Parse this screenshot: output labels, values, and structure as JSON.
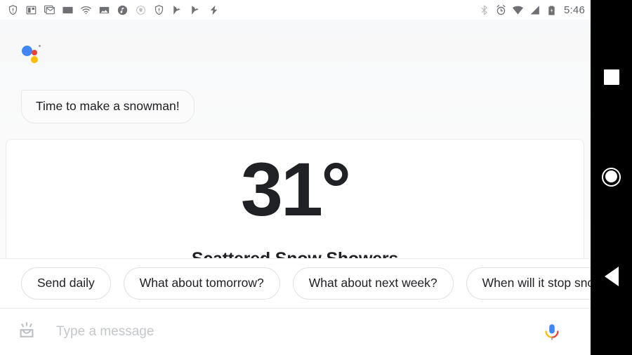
{
  "statusbar": {
    "left_icons": [
      {
        "name": "shield-alert-icon"
      },
      {
        "name": "split-view-icon"
      },
      {
        "name": "gmail-stack-icon"
      },
      {
        "name": "email-icon"
      },
      {
        "name": "wifi-icon"
      },
      {
        "name": "photos-icon"
      },
      {
        "name": "music-note-icon"
      },
      {
        "name": "small-shield-icon"
      },
      {
        "name": "shield-alert-icon-2"
      },
      {
        "name": "flag-check-icon"
      },
      {
        "name": "flag-check-icon-2"
      },
      {
        "name": "lightning-bolt-icon"
      }
    ],
    "right_icons": [
      {
        "name": "bluetooth-icon"
      },
      {
        "name": "alarm-icon"
      },
      {
        "name": "wifi-signal-icon"
      },
      {
        "name": "cell-signal-icon"
      },
      {
        "name": "battery-charging-icon"
      }
    ],
    "time": "5:46"
  },
  "assistant": {
    "logo_name": "google-assistant-logo",
    "logo_colors": {
      "blue": "#4285f4",
      "red": "#ea4335",
      "yellow": "#fbbc05",
      "grey": "#9aa0a6"
    },
    "bubble_text": "Time to make a snowman!"
  },
  "weather_card": {
    "temperature": "31°",
    "condition": "Scattered Snow Showers"
  },
  "suggestion_chips": [
    {
      "label": "Send daily"
    },
    {
      "label": "What about tomorrow?"
    },
    {
      "label": "What about next week?"
    },
    {
      "label": "When will it stop snowing?"
    }
  ],
  "input_bar": {
    "lens_icon_name": "lens-explore-icon",
    "placeholder": "Type a message",
    "value": "",
    "mic_icon_name": "google-mic-icon",
    "mic_colors": {
      "blue": "#4285f4",
      "red": "#ea4335",
      "yellow": "#fbbc05",
      "grey": "#9aa0a6"
    }
  },
  "navbar": {
    "background": "#000000",
    "recents_label": "Overview",
    "home_label": "Home",
    "back_label": "Back"
  }
}
